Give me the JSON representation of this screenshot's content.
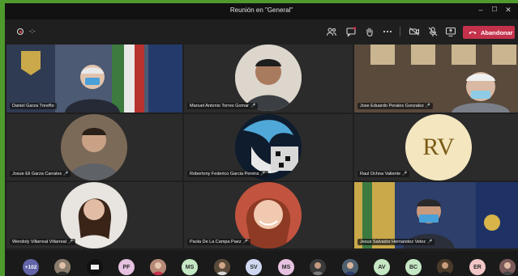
{
  "window": {
    "title": "Reunión en \"General\"",
    "controls": {
      "minimize": "–",
      "maximize": "☐",
      "close": "✕"
    }
  },
  "toolbar": {
    "timer": "-:-",
    "icons": [
      "participants-icon",
      "chat-icon",
      "raise-hand-icon",
      "more-options-icon",
      "camera-off-icon",
      "mic-off-icon",
      "share-screen-icon"
    ],
    "leave_label": "Abandonar",
    "leave_color": "#c4314b"
  },
  "participants": [
    {
      "name": "Daniel Garza Treviño",
      "type": "video"
    },
    {
      "name": "Manuel Antonio Torres Gomar",
      "type": "photo"
    },
    {
      "name": "Jose Eduardo Perales Gonzalez",
      "type": "video"
    },
    {
      "name": "Josue Eli Garza Carrales",
      "type": "photo"
    },
    {
      "name": "Robertony Federico Garcia Pereira",
      "type": "photo"
    },
    {
      "name": "Raul Ochoa Valiente",
      "type": "initials",
      "initials": "RV",
      "color": "#f4e6bf"
    },
    {
      "name": "Wendoly Villarreal Villarreal",
      "type": "photo"
    },
    {
      "name": "Paola De La Campa Paez",
      "type": "photo"
    },
    {
      "name": "Jesus Salvador Hernandez Velez",
      "type": "video"
    }
  ],
  "bottom_bar": {
    "overflow_count": "+102",
    "overflow_color": "#6264a7",
    "avatars": [
      {
        "type": "photo"
      },
      {
        "type": "logo"
      },
      {
        "initials": "PF",
        "color": "#e6c1e0"
      },
      {
        "type": "photo"
      },
      {
        "initials": "MS",
        "color": "#c6e7c4"
      },
      {
        "type": "photo"
      },
      {
        "initials": "SV",
        "color": "#cfd8f0"
      },
      {
        "initials": "MS",
        "color": "#e6c1e0"
      },
      {
        "type": "photo"
      },
      {
        "type": "photo"
      },
      {
        "initials": "AV",
        "color": "#c6e7c4"
      },
      {
        "initials": "BC",
        "color": "#c6e7c4"
      },
      {
        "type": "photo"
      },
      {
        "initials": "ER",
        "color": "#f2c6c6"
      },
      {
        "type": "photo"
      }
    ]
  }
}
